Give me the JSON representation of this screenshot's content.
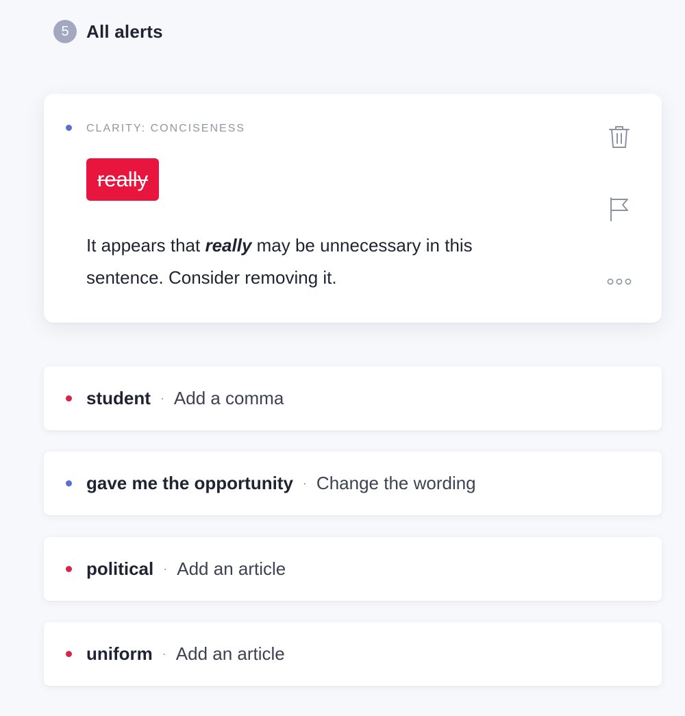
{
  "header": {
    "count": "5",
    "title": "All alerts"
  },
  "colors": {
    "correctness_dot": "#d8234b",
    "clarity_dot": "#5a6fd6",
    "chip_background": "#e8163f"
  },
  "active_alert": {
    "dot_color": "#5a6fd6",
    "category": "CLARITY: CONCISENESS",
    "suggestion": "really",
    "message_before": "It appears that ",
    "message_emphasis": "really",
    "message_after": " may be unnecessary in this sentence. Consider removing it.",
    "actions": [
      {
        "name": "trash-icon",
        "label": "Dismiss"
      },
      {
        "name": "flag-icon",
        "label": "Flag"
      },
      {
        "name": "more-icon",
        "label": "More"
      }
    ]
  },
  "alerts": [
    {
      "word": "student",
      "separator": "·",
      "action": "Add a comma",
      "dot_color": "#d8234b"
    },
    {
      "word": "gave me the opportunity",
      "separator": "·",
      "action": "Change the wording",
      "dot_color": "#5a6fd6"
    },
    {
      "word": "political",
      "separator": "·",
      "action": "Add an article",
      "dot_color": "#d8234b"
    },
    {
      "word": "uniform",
      "separator": "·",
      "action": "Add an article",
      "dot_color": "#d8234b"
    }
  ]
}
